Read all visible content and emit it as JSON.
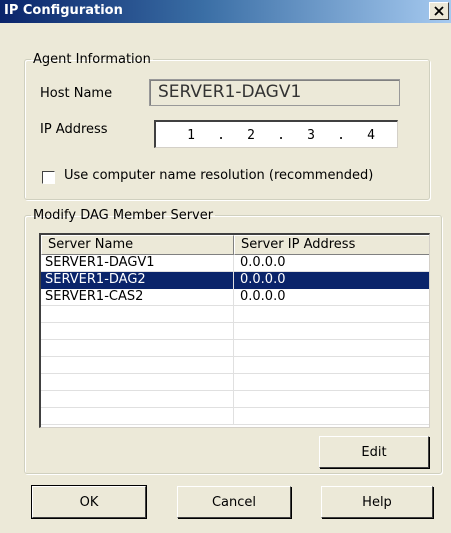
{
  "window": {
    "title": "IP Configuration",
    "close_icon": "close-icon"
  },
  "agent_info": {
    "legend": "Agent Information",
    "host_name_label": "Host Name",
    "host_name_value": "SERVER1-DAGV1",
    "ip_address_label": "IP Address",
    "ip_octets": [
      "1",
      "2",
      "3",
      "4"
    ],
    "ip_separator": ".",
    "checkbox_label": "Use computer name resolution (recommended)",
    "checkbox_checked": false
  },
  "dag_member": {
    "legend": "Modify DAG Member Server",
    "columns": [
      "Server Name",
      "Server IP Address"
    ],
    "rows": [
      {
        "name": "SERVER1-DAGV1",
        "ip": "0.0.0.0",
        "selected": false
      },
      {
        "name": "SERVER1-DAG2",
        "ip": "0.0.0.0",
        "selected": true
      },
      {
        "name": "SERVER1-CAS2",
        "ip": "0.0.0.0",
        "selected": false
      }
    ],
    "edit_label": "Edit"
  },
  "buttons": {
    "ok_label": "OK",
    "cancel_label": "Cancel",
    "help_label": "Help"
  },
  "colors": {
    "selection": "#0a246a",
    "title_gradient_start": "#0a246a",
    "dialog_background": "#ece9d8"
  }
}
